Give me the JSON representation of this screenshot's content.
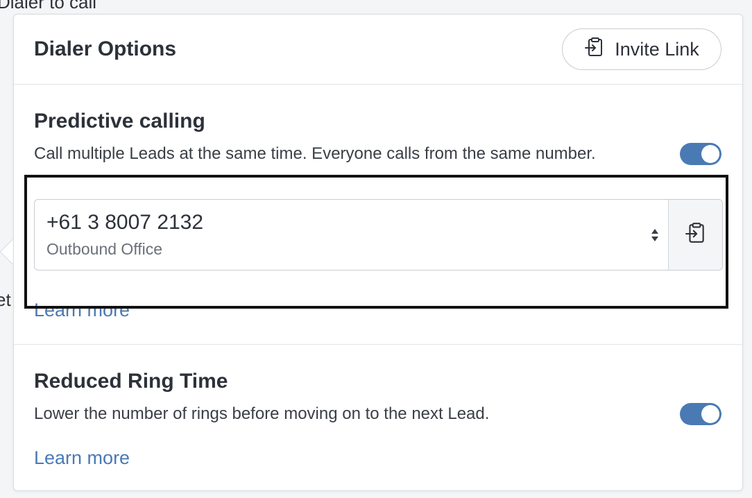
{
  "background": {
    "top_text": "Dialer to call",
    "left_text": "et"
  },
  "panel": {
    "title": "Dialer Options",
    "invite_button": {
      "label": "Invite Link",
      "icon": "clipboard-login-icon"
    }
  },
  "predictive_calling": {
    "title": "Predictive calling",
    "description": "Call multiple Leads at the same time. Everyone calls from the same number.",
    "enabled": true,
    "phone_select": {
      "number": "+61 3 8007 2132",
      "label": "Outbound Office",
      "caret_icon": "select-caret-icon",
      "action_icon": "clipboard-login-icon"
    },
    "learn_more": "Learn more"
  },
  "reduced_ring_time": {
    "title": "Reduced Ring Time",
    "description": "Lower the number of rings before moving on to the next Lead.",
    "enabled": true,
    "learn_more": "Learn more"
  },
  "colors": {
    "accent": "#4a7ab3",
    "text": "#2d3139",
    "border": "#d8dbe0",
    "highlight": "#111111"
  }
}
